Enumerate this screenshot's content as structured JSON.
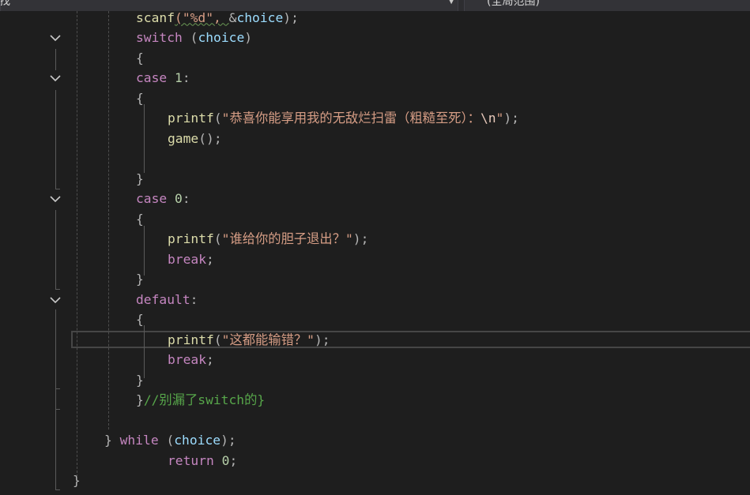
{
  "toolbar": {
    "scope_left": "找",
    "scope_right": "(全局范围)"
  },
  "code_lines": [
    {
      "tokens": [
        {
          "t": "scanf",
          "c": "fn"
        },
        {
          "t": "(\"%d\", ",
          "c": "str"
        },
        {
          "t": "&",
          "c": "pun"
        },
        {
          "t": "choice",
          "c": "var"
        },
        {
          "t": ");",
          "c": "pun"
        }
      ]
    },
    {
      "tokens": [
        {
          "t": "switch",
          "c": "kw"
        },
        {
          "t": " (",
          "c": "pun"
        },
        {
          "t": "choice",
          "c": "var"
        },
        {
          "t": ")",
          "c": "pun"
        }
      ]
    },
    {
      "tokens": [
        {
          "t": "{",
          "c": "pun"
        }
      ]
    },
    {
      "tokens": [
        {
          "t": "case",
          "c": "kw"
        },
        {
          "t": " ",
          "c": "pun"
        },
        {
          "t": "1",
          "c": "num"
        },
        {
          "t": ":",
          "c": "pun"
        }
      ]
    },
    {
      "tokens": [
        {
          "t": "{",
          "c": "pun"
        }
      ]
    },
    {
      "tokens": [
        {
          "t": "printf",
          "c": "fn"
        },
        {
          "t": "(",
          "c": "pun"
        },
        {
          "t": "\"恭喜你能享用我的无敌烂扫雷（粗糙至死）：",
          "c": "str"
        },
        {
          "t": "\\n",
          "c": "esc"
        },
        {
          "t": "\"",
          "c": "str"
        },
        {
          "t": ");",
          "c": "pun"
        }
      ]
    },
    {
      "tokens": [
        {
          "t": "game",
          "c": "fn"
        },
        {
          "t": "();",
          "c": "pun"
        }
      ]
    },
    {
      "tokens": []
    },
    {
      "tokens": [
        {
          "t": "}",
          "c": "pun"
        }
      ]
    },
    {
      "tokens": [
        {
          "t": "case",
          "c": "kw"
        },
        {
          "t": " ",
          "c": "pun"
        },
        {
          "t": "0",
          "c": "num"
        },
        {
          "t": ":",
          "c": "pun"
        }
      ]
    },
    {
      "tokens": [
        {
          "t": "{",
          "c": "pun"
        }
      ]
    },
    {
      "tokens": [
        {
          "t": "printf",
          "c": "fn"
        },
        {
          "t": "(",
          "c": "pun"
        },
        {
          "t": "\"谁给你的胆子退出？\"",
          "c": "str"
        },
        {
          "t": ");",
          "c": "pun"
        }
      ]
    },
    {
      "tokens": [
        {
          "t": "break",
          "c": "kw"
        },
        {
          "t": ";",
          "c": "pun"
        }
      ]
    },
    {
      "tokens": [
        {
          "t": "}",
          "c": "pun"
        }
      ]
    },
    {
      "tokens": [
        {
          "t": "default",
          "c": "kw"
        },
        {
          "t": ":",
          "c": "pun"
        }
      ]
    },
    {
      "tokens": [
        {
          "t": "{",
          "c": "pun"
        }
      ]
    },
    {
      "tokens": [
        {
          "t": "printf",
          "c": "fn"
        },
        {
          "t": "(",
          "c": "pun"
        },
        {
          "t": "\"这都能输错？\"",
          "c": "str"
        },
        {
          "t": ");",
          "c": "pun"
        }
      ]
    },
    {
      "tokens": [
        {
          "t": "break",
          "c": "kw"
        },
        {
          "t": ";",
          "c": "pun"
        }
      ]
    },
    {
      "tokens": [
        {
          "t": "}",
          "c": "pun"
        }
      ]
    },
    {
      "tokens": [
        {
          "t": "}",
          "c": "pun"
        },
        {
          "t": "//别漏了switch的}",
          "c": "cmt"
        }
      ]
    },
    {
      "tokens": []
    },
    {
      "tokens": [
        {
          "t": "}",
          "c": "pun"
        },
        {
          "t": " ",
          "c": "pun"
        },
        {
          "t": "while",
          "c": "kw"
        },
        {
          "t": " (",
          "c": "pun"
        },
        {
          "t": "choice",
          "c": "var"
        },
        {
          "t": ");",
          "c": "pun"
        }
      ]
    },
    {
      "tokens": [
        {
          "t": "return",
          "c": "kw"
        },
        {
          "t": " ",
          "c": "pun"
        },
        {
          "t": "0",
          "c": "num"
        },
        {
          "t": ";",
          "c": "pun"
        }
      ]
    },
    {
      "tokens": [
        {
          "t": "}",
          "c": "pun"
        }
      ]
    }
  ]
}
